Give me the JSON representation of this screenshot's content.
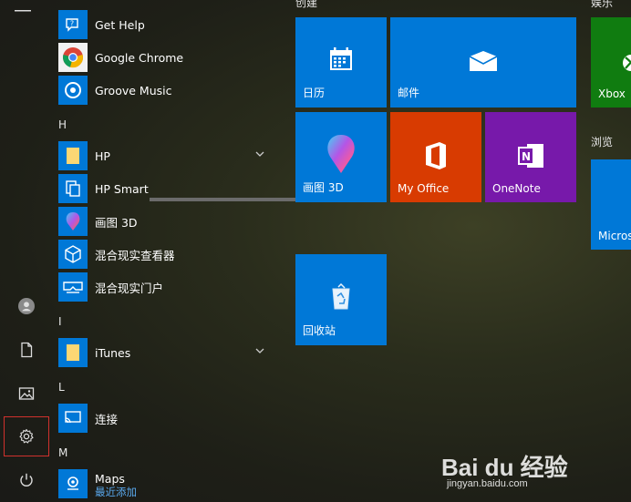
{
  "rail": {
    "items": [
      "menu",
      "user",
      "documents",
      "pictures",
      "settings",
      "power"
    ]
  },
  "apps": {
    "get_help": "Get Help",
    "chrome": "Google Chrome",
    "groove": "Groove Music",
    "letter_h": "H",
    "hp": "HP",
    "hp_smart": "HP Smart",
    "paint3d": "画图 3D",
    "mr_viewer": "混合现实查看器",
    "mr_portal": "混合现实门户",
    "letter_i": "I",
    "itunes": "iTunes",
    "letter_l": "L",
    "connect": "连接",
    "letter_m": "M",
    "maps": "Maps",
    "maps_sub": "最近添加"
  },
  "groups": {
    "create": "创建",
    "play": "娱乐",
    "browse": "浏览"
  },
  "tiles": {
    "calendar": "日历",
    "mail": "邮件",
    "paint3d": "画图 3D",
    "myoffice": "My Office",
    "onenote": "OneNote",
    "recycle": "回收站",
    "xbox": "Xbox",
    "edge": "Micros"
  },
  "colors": {
    "tile_blue": "#0078d7",
    "office_red": "#d83b01",
    "onenote_purple": "#7719aa",
    "xbox_green": "#107c10",
    "selection_red": "#d0312d"
  },
  "watermark": {
    "logo": "Bai du 经验",
    "url": "jingyan.baidu.com"
  }
}
